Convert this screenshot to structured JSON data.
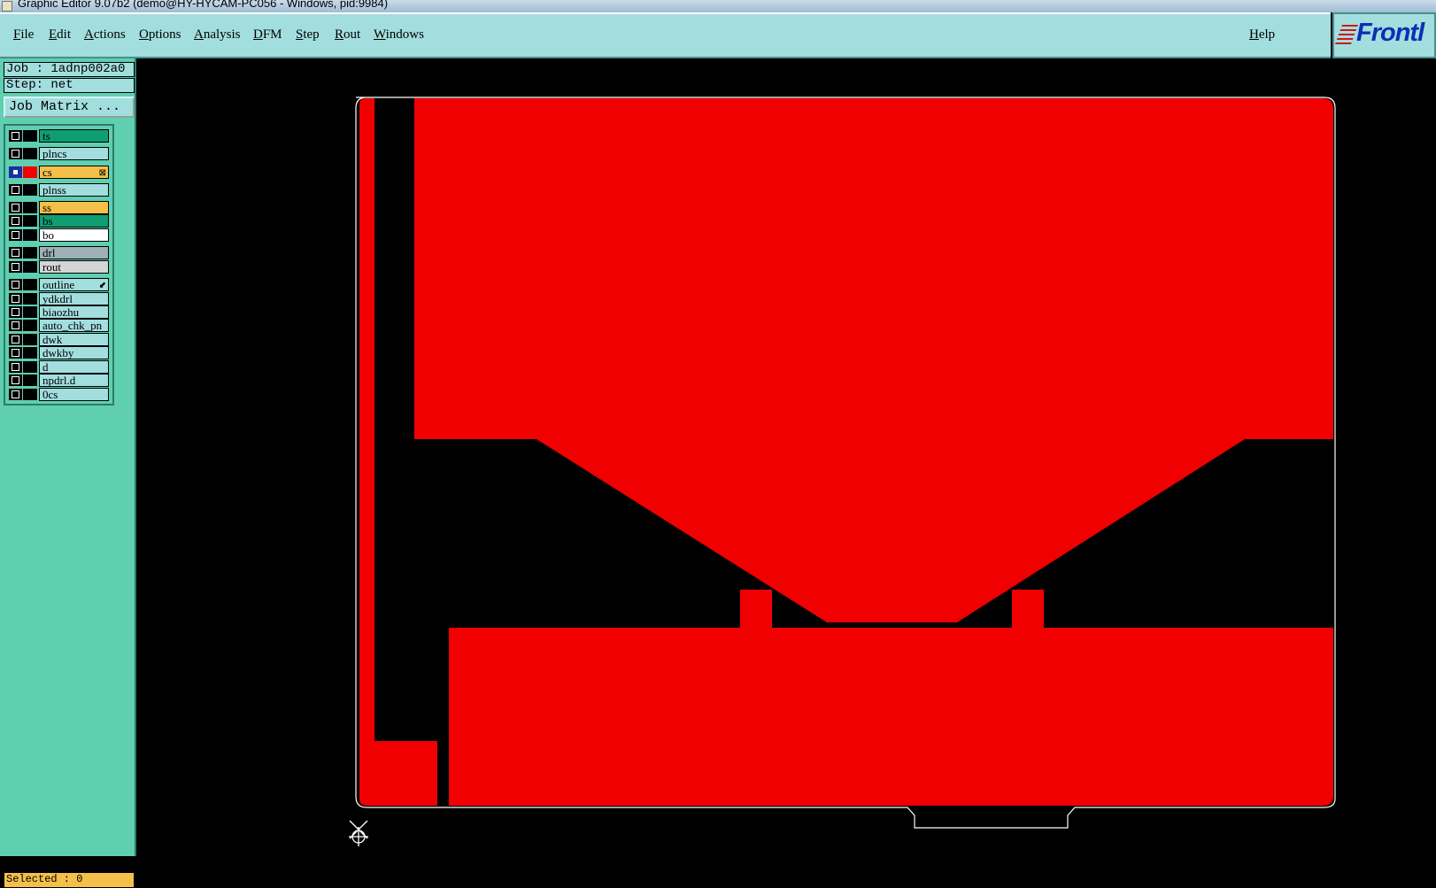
{
  "window": {
    "title": "Graphic Editor 9.07b2 (demo@HY-HYCAM-PC056 - Windows, pid:9984)"
  },
  "menu": {
    "items": [
      "File",
      "Edit",
      "Actions",
      "Options",
      "Analysis",
      "DFM",
      "Step",
      "Rout",
      "Windows"
    ],
    "help": "Help"
  },
  "logo": {
    "text": "Frontl"
  },
  "job": {
    "label": "Job : 1adnp002a0",
    "step": "Step: net"
  },
  "job_matrix_button": "Job Matrix ...",
  "layers": [
    {
      "name": "ts",
      "color": "#0e9e72",
      "active": false
    },
    {
      "name": "plncs",
      "color": "#a3dede",
      "active": false
    },
    {
      "name": "cs",
      "color": "#f5c04a",
      "active": true,
      "mark": "⊠"
    },
    {
      "name": "plnss",
      "color": "#a3dede",
      "active": false
    },
    {
      "name": "ss",
      "color": "#f5c04a",
      "active": false
    },
    {
      "name": "bs",
      "color": "#0e9e72",
      "active": false
    },
    {
      "name": "bo",
      "color": "#ffffff",
      "active": false
    },
    {
      "name": "drl",
      "color": "#9fb1b6",
      "active": false
    },
    {
      "name": "rout",
      "color": "#d5d5d5",
      "active": false
    },
    {
      "name": "outline",
      "color": "#a3dede",
      "active": false,
      "mark": "⬋"
    },
    {
      "name": "ydkdrl",
      "color": "#a3dede",
      "active": false
    },
    {
      "name": "biaozhu",
      "color": "#a3dede",
      "active": false
    },
    {
      "name": "auto_chk_pn",
      "color": "#a3dede",
      "active": false
    },
    {
      "name": "dwk",
      "color": "#a3dede",
      "active": false
    },
    {
      "name": "dwkby",
      "color": "#a3dede",
      "active": false
    },
    {
      "name": "d",
      "color": "#a3dede",
      "active": false
    },
    {
      "name": "npdrl.d",
      "color": "#a3dede",
      "active": false
    },
    {
      "name": "0cs",
      "color": "#a3dede",
      "active": false
    }
  ],
  "status": {
    "selected": "Selected : 0"
  },
  "colors": {
    "copper": "#f00000",
    "outline": "#ffffff",
    "background": "#000000"
  },
  "icons": [
    "crosshair-icon",
    "app-icon"
  ]
}
